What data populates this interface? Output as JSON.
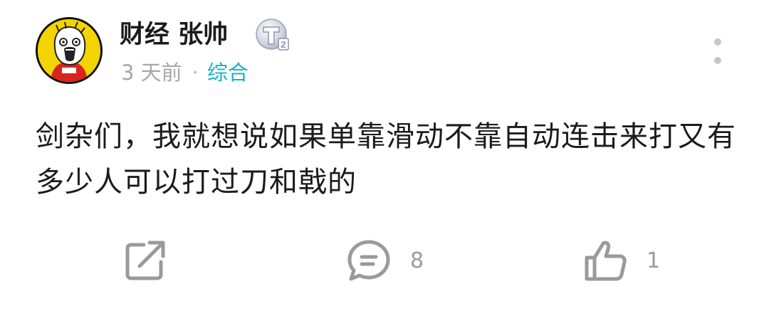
{
  "author": {
    "name": "财经 张帅",
    "badge_letter": "T",
    "badge_level": "2"
  },
  "meta": {
    "time": "3 天前",
    "separator": "·",
    "category": "综合"
  },
  "post": {
    "text": "剑杂们，我就想说如果单靠滑动不靠自动连击来打又有多少人可以打过刀和戟的"
  },
  "actions": {
    "share_icon": "share-icon",
    "comment_icon": "comment-icon",
    "comment_count": "8",
    "like_icon": "thumbs-up-icon",
    "like_count": "1"
  },
  "colors": {
    "accent": "#17b3c3",
    "text": "#1b1b1b",
    "muted": "#a7a7a7",
    "icon": "#9a9a9a"
  }
}
